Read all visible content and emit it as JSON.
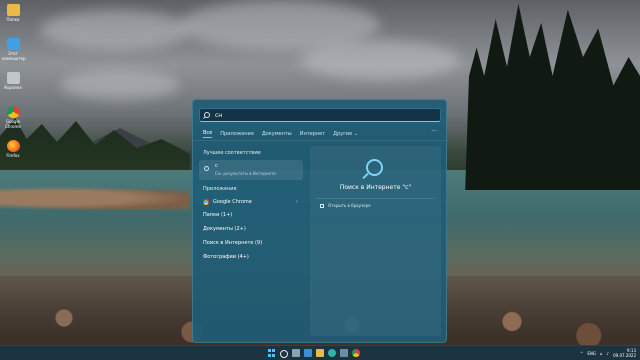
{
  "desktop": {
    "icons": [
      {
        "label": "Папка",
        "icon": "folder-icon",
        "color": "#e9b949"
      },
      {
        "label": "Этот компьютер",
        "icon": "computer-icon",
        "color": "#3fa1e3"
      },
      {
        "label": "Корзина",
        "icon": "recycle-bin-icon",
        "color": "#bfc6cc"
      },
      {
        "label": "Google Chrome",
        "icon": "chrome-icon",
        "color": "#db4437"
      },
      {
        "label": "Firefox",
        "icon": "firefox-icon",
        "color": "#f76b1c"
      }
    ]
  },
  "search": {
    "query": "cн",
    "tabs": [
      "Все",
      "Приложения",
      "Документы",
      "Интернет",
      "Другие"
    ],
    "more_menu": "···",
    "best_match_title": "Лучшее соответствие",
    "best_match_query": "c",
    "best_match_hint": "См. результаты в Интернете",
    "apps_title": "Приложения",
    "app_name": "Google Chrome",
    "categories": [
      "Папки (1+)",
      "Документы (2+)",
      "Поиск в Интернете (9)",
      "Фотографии (4+)"
    ],
    "web_title": "Поиск в Интернете \"c\"",
    "open_in_browser": "Открыть в браузере"
  },
  "taskbar": {
    "tray_caret": "^",
    "language": "ENG",
    "time": "9:13",
    "date": "09.07.2022"
  },
  "colors": {
    "accent": "#4cc2ff",
    "panel": "#1f5c75",
    "taskbar": "#1c3340"
  }
}
